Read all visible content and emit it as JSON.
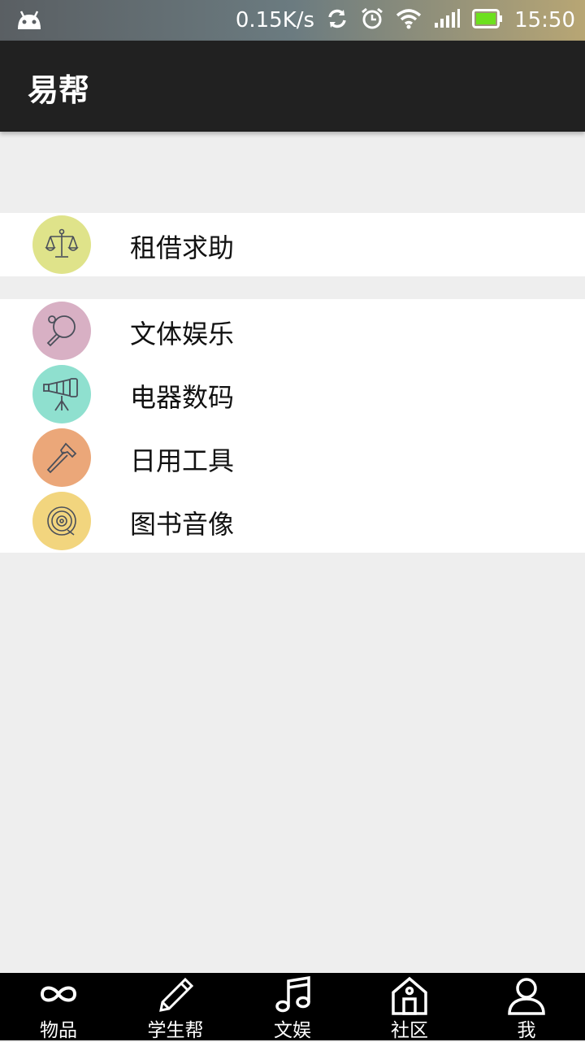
{
  "status_bar": {
    "network_speed": "0.15K/s",
    "time": "15:50",
    "icons": [
      "android-icon",
      "sync-icon",
      "alarm-icon",
      "wifi-icon",
      "signal-icon",
      "battery-icon"
    ]
  },
  "app_bar": {
    "title": "易帮"
  },
  "groups": [
    {
      "items": [
        {
          "label": "租借求助",
          "icon": "scales-icon",
          "color": "#dfe38a"
        }
      ]
    },
    {
      "items": [
        {
          "label": "文体娱乐",
          "icon": "ping-pong-icon",
          "color": "#d8b0c4"
        },
        {
          "label": "电器数码",
          "icon": "camera-icon",
          "color": "#8fe0cf"
        },
        {
          "label": "日用工具",
          "icon": "hammer-icon",
          "color": "#eba779"
        },
        {
          "label": "图书音像",
          "icon": "disc-icon",
          "color": "#f2d57e"
        }
      ]
    }
  ],
  "bottom_nav": [
    {
      "label": "物品",
      "icon": "infinity-icon"
    },
    {
      "label": "学生帮",
      "icon": "pencil-icon"
    },
    {
      "label": "文娱",
      "icon": "music-note-icon"
    },
    {
      "label": "社区",
      "icon": "house-icon"
    },
    {
      "label": "我",
      "icon": "person-icon"
    }
  ]
}
